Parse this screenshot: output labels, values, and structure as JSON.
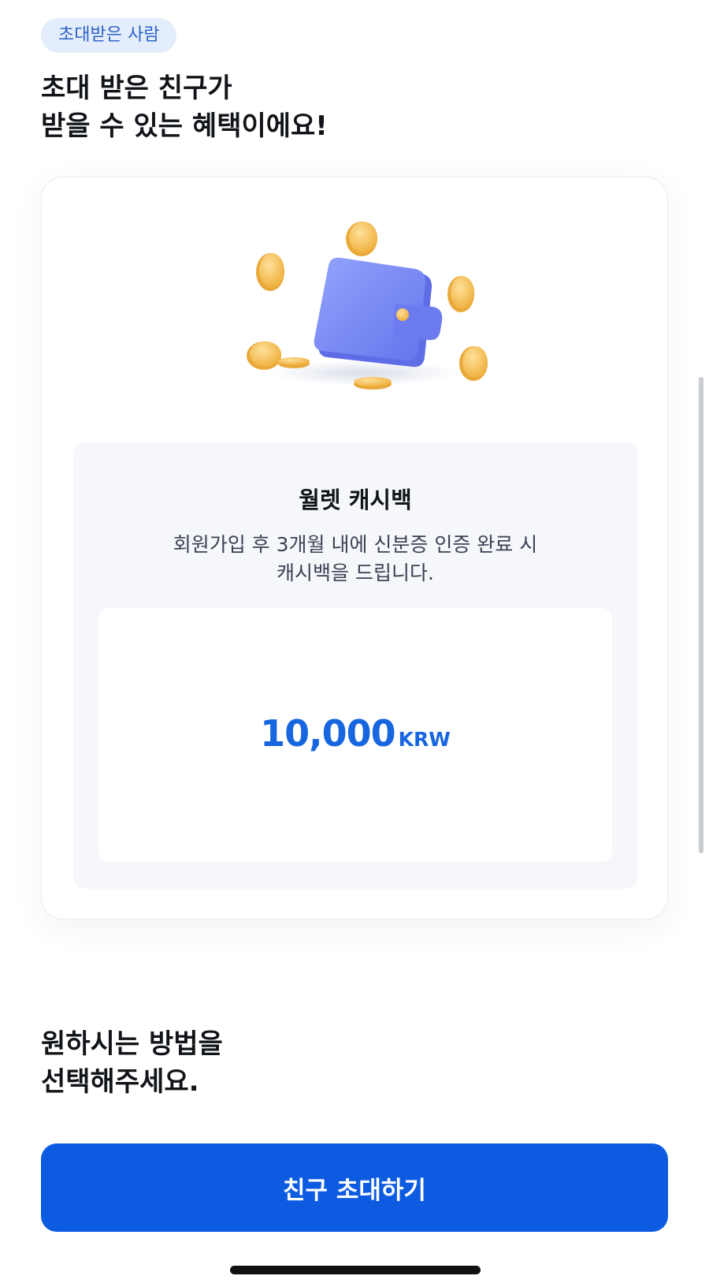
{
  "badge": {
    "label": "초대받은 사람"
  },
  "headline": {
    "line1": "초대 받은 친구가",
    "line2": "받을 수 있는 혜택이에요!"
  },
  "benefit_card": {
    "illustration_icon": "wallet-with-coins-icon",
    "title": "월렛 캐시백",
    "description_line1": "회원가입 후 3개월 내에 신분증 인증 완료 시",
    "description_line2": "캐시백을 드립니다.",
    "amount_value": "10,000",
    "amount_unit": "KRW"
  },
  "choose": {
    "line1": "원하시는 방법을",
    "line2": "선택해주세요."
  },
  "cta": {
    "label": "친구 초대하기"
  },
  "colors": {
    "primary": "#0d5be1",
    "amount_text": "#1766e0",
    "badge_bg": "#e3edfb",
    "badge_text": "#2f62c8",
    "wallet": "#7e8ef5",
    "coin": "#f3bd4f"
  }
}
